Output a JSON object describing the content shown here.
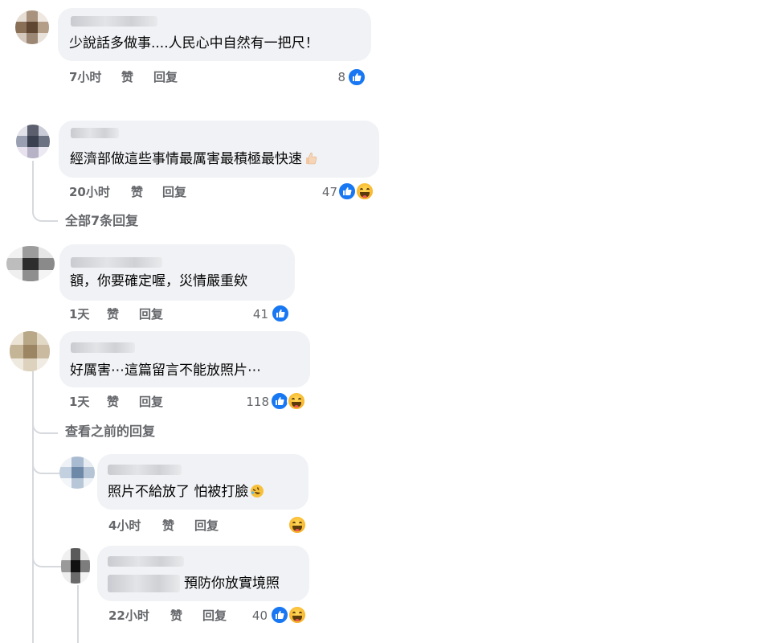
{
  "comments": [
    {
      "text": "少說話多做事....人民心中自然有一把尺！",
      "time": "7小时",
      "like": "赞",
      "reply": "回复",
      "count": "8",
      "reactions": [
        "like"
      ]
    },
    {
      "text": "經濟部做這些事情最厲害最積極最快速",
      "emoji": "thumbs-up-emoji",
      "time": "20小时",
      "like": "赞",
      "reply": "回复",
      "count": "47",
      "reactions": [
        "like",
        "haha"
      ],
      "view_replies": "全部7条回复"
    },
    {
      "text": "額，你要確定喔，災情嚴重欸",
      "time": "1天",
      "like": "赞",
      "reply": "回复",
      "count": "41",
      "reactions": [
        "like"
      ]
    },
    {
      "text": "好厲害⋯這篇留言不能放照片⋯",
      "time": "1天",
      "like": "赞",
      "reply": "回复",
      "count": "118",
      "reactions": [
        "like",
        "haha"
      ],
      "view_previous": "查看之前的回复",
      "replies": [
        {
          "text": "照片不給放了 怕被打臉",
          "emoji": "rofl-emoji",
          "time": "4小时",
          "like": "赞",
          "reply": "回复",
          "count": "",
          "reactions": [
            "haha"
          ]
        },
        {
          "text": "預防你放實境照",
          "time": "22小时",
          "like": "赞",
          "reply": "回复",
          "count": "40",
          "reactions": [
            "like",
            "haha"
          ]
        }
      ]
    }
  ],
  "colors": {
    "bubble": "#f0f2f5",
    "meta": "#65676b",
    "like_blue": "#1877f2",
    "thread_line": "#d6d9dd"
  }
}
